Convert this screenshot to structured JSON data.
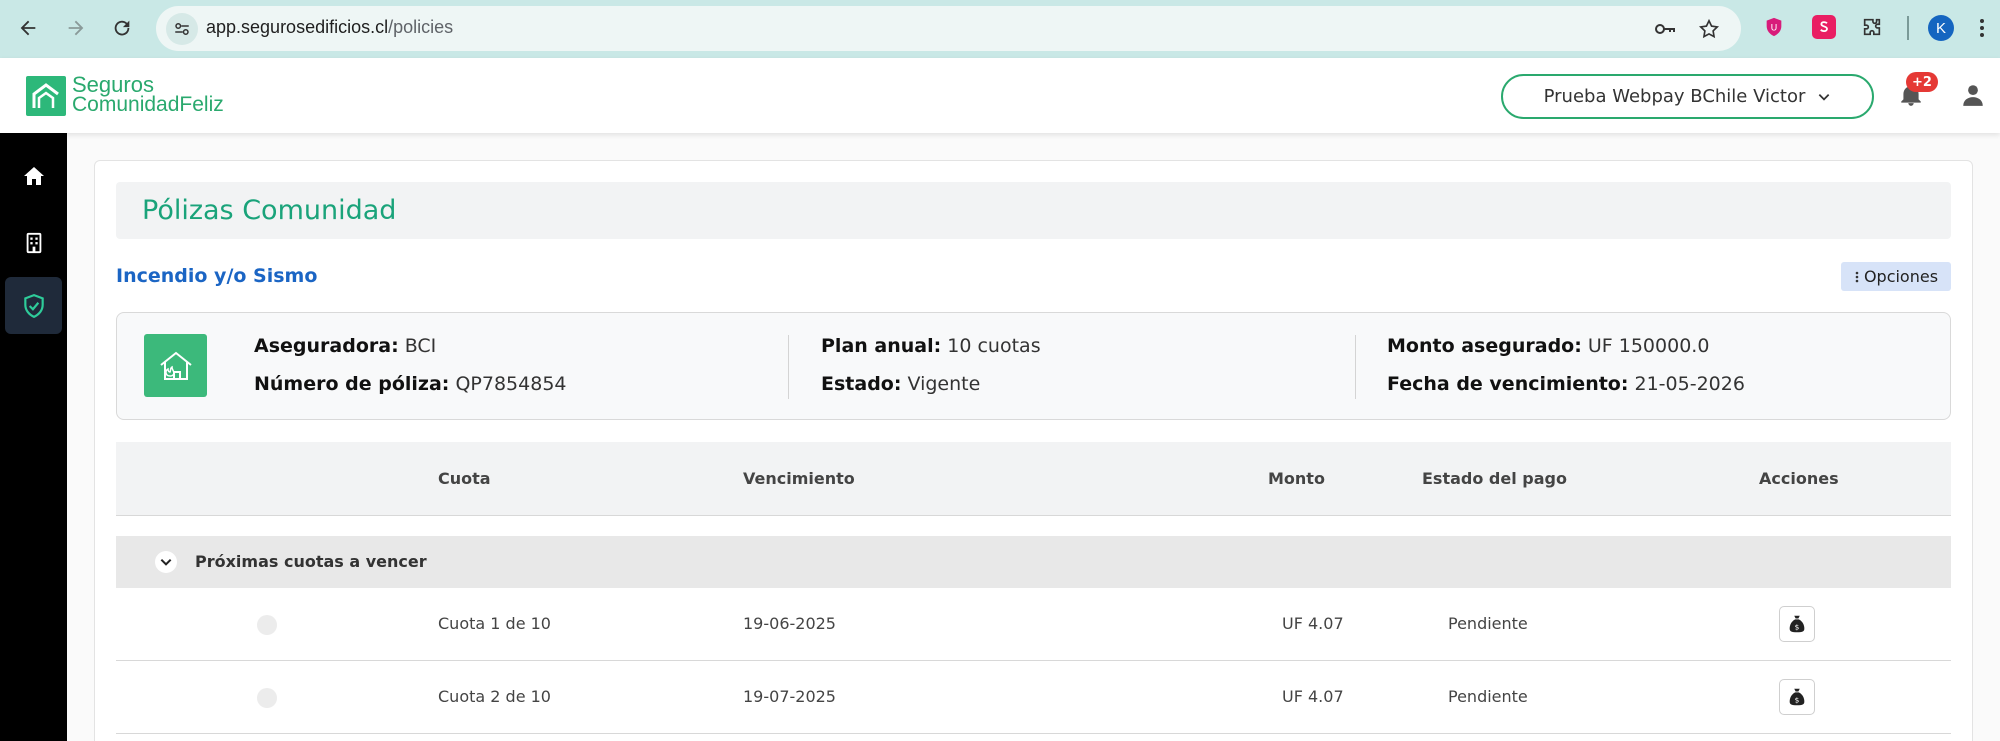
{
  "browser": {
    "url_domain": "app.segurosedificios.cl",
    "url_path": "/policies",
    "profile_initial": "K"
  },
  "header": {
    "logo_line1": "Seguros",
    "logo_line2": "ComunidadFeliz",
    "community_selector": "Prueba Webpay BChile Victor",
    "notifications_badge": "+2"
  },
  "sidebar": {
    "items": [
      {
        "icon": "home-icon",
        "active": false
      },
      {
        "icon": "building-icon",
        "active": false
      },
      {
        "icon": "shield-check-icon",
        "active": true
      }
    ]
  },
  "page": {
    "title": "Pólizas Comunidad",
    "section_title": "Incendio y/o Sismo",
    "options_label": "Opciones"
  },
  "policy": {
    "insurer_label": "Aseguradora:",
    "insurer_value": "BCI",
    "number_label": "Número de póliza:",
    "number_value": "QP7854854",
    "plan_label": "Plan anual:",
    "plan_value": "10 cuotas",
    "status_label": "Estado:",
    "status_value": "Vigente",
    "amount_label": "Monto asegurado:",
    "amount_value": "UF 150000.0",
    "expiry_label": "Fecha de vencimiento:",
    "expiry_value": "21-05-2026"
  },
  "table": {
    "headers": {
      "cuota": "Cuota",
      "vencimiento": "Vencimiento",
      "monto": "Monto",
      "estado": "Estado del pago",
      "acciones": "Acciones"
    },
    "group_label": "Próximas cuotas a vencer",
    "rows": [
      {
        "cuota": "Cuota 1 de 10",
        "vencimiento": "19-06-2025",
        "monto": "UF 4.07",
        "estado": "Pendiente"
      },
      {
        "cuota": "Cuota 2 de 10",
        "vencimiento": "19-07-2025",
        "monto": "UF 4.07",
        "estado": "Pendiente"
      }
    ]
  },
  "colors": {
    "brand_green": "#2aa96e",
    "title_teal": "#1aa37a",
    "section_blue": "#1b65c4",
    "badge_red": "#e53935"
  }
}
